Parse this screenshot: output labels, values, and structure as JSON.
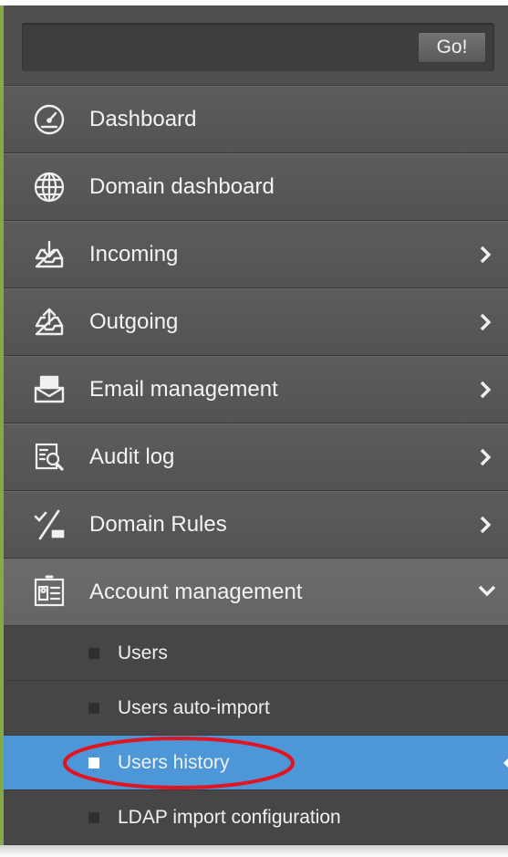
{
  "search": {
    "placeholder": "",
    "value": "",
    "go_label": "Go!"
  },
  "menu": [
    {
      "label": "Dashboard",
      "icon": "dashboard-gauge-icon",
      "accent": "#6a8fd0",
      "chevron": false
    },
    {
      "label": "Domain dashboard",
      "icon": "globe-icon",
      "accent": "#c25252",
      "chevron": false
    },
    {
      "label": "Incoming",
      "icon": "inbox-download-icon",
      "accent": "#86a84a",
      "chevron": true
    },
    {
      "label": "Outgoing",
      "icon": "outbox-upload-icon",
      "accent": "#b04949",
      "chevron": true
    },
    {
      "label": "Email management",
      "icon": "email-tray-icon",
      "accent": "#c7a234",
      "chevron": true
    },
    {
      "label": "Audit log",
      "icon": "audit-search-icon",
      "accent": "#a9435f",
      "chevron": true
    },
    {
      "label": "Domain Rules",
      "icon": "rules-percent-icon",
      "accent": "#7e9d3e",
      "chevron": true
    },
    {
      "label": "Account management",
      "icon": "account-card-icon",
      "accent": "#6a8fd0",
      "chevron": "down",
      "active": true
    }
  ],
  "submenu": [
    {
      "label": "Users"
    },
    {
      "label": "Users auto-import"
    },
    {
      "label": "Users history",
      "selected": true
    },
    {
      "label": "LDAP import configuration"
    }
  ],
  "colors": {
    "sidebar_bg": "#4e4e4e",
    "selected_bg": "#4d97d8",
    "annotation": "#e0151f"
  }
}
